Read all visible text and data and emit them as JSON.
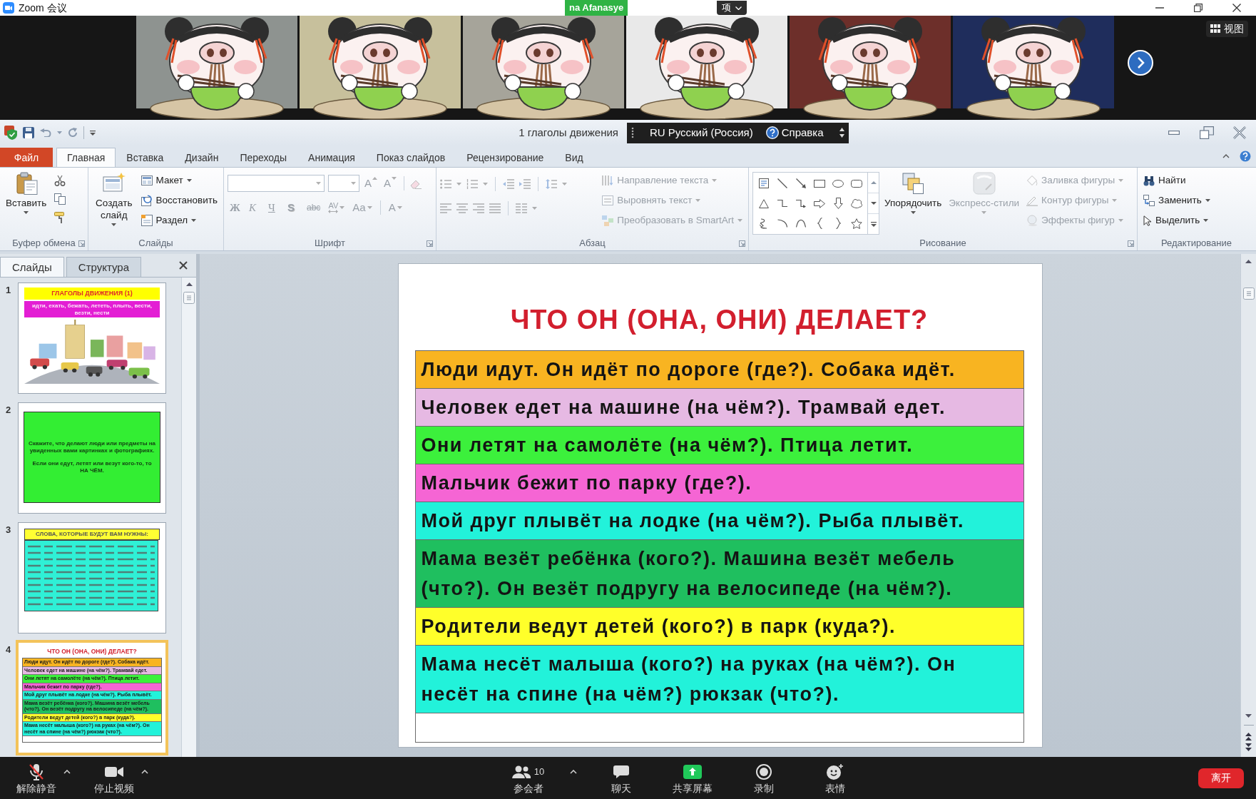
{
  "zoom_window": {
    "title": "Zoom 会议",
    "share_label": "na Afanasye",
    "options_button": "项",
    "view_button": "视图"
  },
  "powerpoint": {
    "title": "1 глаголы движения",
    "language_bar": {
      "code": "RU",
      "language": "Русский (Россия)",
      "help": "Справка"
    },
    "tabs": [
      {
        "label": "Файл",
        "kind": "file",
        "selected": false
      },
      {
        "label": "Главная",
        "kind": "tab",
        "selected": true
      },
      {
        "label": "Вставка",
        "kind": "tab",
        "selected": false
      },
      {
        "label": "Дизайн",
        "kind": "tab",
        "selected": false
      },
      {
        "label": "Переходы",
        "kind": "tab",
        "selected": false
      },
      {
        "label": "Анимация",
        "kind": "tab",
        "selected": false
      },
      {
        "label": "Показ слайдов",
        "kind": "tab",
        "selected": false
      },
      {
        "label": "Рецензирование",
        "kind": "tab",
        "selected": false
      },
      {
        "label": "Вид",
        "kind": "tab",
        "selected": false
      }
    ],
    "ribbon_groups": [
      {
        "kind": "clipboard",
        "title": "Буфер обмена",
        "launcher": true,
        "disabled": false,
        "large_buttons": [
          {
            "label": "Вставить",
            "dropdown": true,
            "disabled": false
          }
        ]
      },
      {
        "kind": "slides",
        "title": "Слайды",
        "launcher": false,
        "disabled": false,
        "large_buttons": [
          {
            "label": "Создать слайд",
            "dropdown": true,
            "disabled": false
          }
        ],
        "buttons": [
          {
            "label": "Макет",
            "dropdown": true,
            "disabled": false
          },
          {
            "label": "Восстановить",
            "dropdown": false,
            "disabled": false
          },
          {
            "label": "Раздел",
            "dropdown": true,
            "disabled": false
          }
        ]
      },
      {
        "kind": "font",
        "title": "Шрифт",
        "launcher": true,
        "disabled": true,
        "size_buttons": [
          {
            "text": "A",
            "kind": "grow"
          },
          {
            "text": "A",
            "kind": "shrink"
          }
        ],
        "format_buttons": [
          {
            "text": "Ж",
            "kind": "bold"
          },
          {
            "text": "К",
            "kind": "italic"
          },
          {
            "text": "Ч",
            "kind": "underline"
          },
          {
            "text": "S",
            "kind": "shadow"
          },
          {
            "text": "abc",
            "kind": "strike"
          },
          {
            "text": "AV",
            "kind": "spacing"
          },
          {
            "text": "Aa",
            "kind": "case"
          },
          {
            "text": "A",
            "kind": "color"
          }
        ]
      },
      {
        "kind": "paragraph",
        "title": "Абзац",
        "launcher": true,
        "disabled": true,
        "buttons": [
          {
            "label": "Направление текста",
            "dropdown": true
          },
          {
            "label": "Выровнять текст",
            "dropdown": true
          },
          {
            "label": "Преобразовать в SmartArt",
            "dropdown": true
          }
        ]
      },
      {
        "kind": "drawing",
        "title": "Рисование",
        "launcher": true,
        "disabled": false,
        "large_buttons": [
          {
            "label": "Упорядочить",
            "dropdown": true,
            "disabled": false
          },
          {
            "label": "Экспресс-стили",
            "dropdown": true,
            "disabled": true
          }
        ],
        "buttons": [
          {
            "label": "Заливка фигуры",
            "dropdown": true,
            "disabled": true
          },
          {
            "label": "Контур фигуры",
            "dropdown": true,
            "disabled": true
          },
          {
            "label": "Эффекты фигур",
            "dropdown": true,
            "disabled": true
          }
        ]
      },
      {
        "kind": "editing",
        "title": "Редактирование",
        "launcher": false,
        "disabled": false,
        "buttons": [
          {
            "label": "Найти",
            "dropdown": false,
            "disabled": false
          },
          {
            "label": "Заменить",
            "dropdown": true,
            "disabled": false
          },
          {
            "label": "Выделить",
            "dropdown": true,
            "disabled": false
          }
        ]
      }
    ],
    "slides_pane": {
      "tabs": [
        {
          "label": "Слайды",
          "selected": true
        },
        {
          "label": "Структура",
          "selected": false
        }
      ],
      "thumbnails": [
        {
          "number": "1",
          "kind": "title",
          "selected": false,
          "title": "ГЛАГОЛЫ ДВИЖЕНИЯ (1)",
          "subtitle": "идти, ехать, бежать, лететь, плыть, вести, везти, нести"
        },
        {
          "number": "2",
          "kind": "text",
          "selected": false,
          "paragraphs": [
            "Скажите, что делают люди или предметы на увиденных вами картинках и фотографиях.",
            "Если они едут, летят или везут кого-то, то НА ЧЁМ."
          ]
        },
        {
          "number": "3",
          "kind": "word_list",
          "selected": false,
          "title": "СЛОВА, КОТОРЫЕ БУДУТ ВАМ НУЖНЫ:"
        },
        {
          "number": "4",
          "kind": "table",
          "selected": true,
          "title": "ЧТО ОН (ОНА, ОНИ) ДЕЛАЕТ?",
          "rows": [
            {
              "text": "Люди идут. Он идёт по дороге (где?). Собака идёт.",
              "color": "#f8b421"
            },
            {
              "text": "Человек едет на машине (на чём?). Трамвай едет.",
              "color": "#e6b9e3"
            },
            {
              "text": "Они летят на самолёте (на чём?). Птица летит.",
              "color": "#3cf03c"
            },
            {
              "text": "Мальчик бежит по парку (где?).",
              "color": "#f565d4"
            },
            {
              "text": "Мой друг плывёт на лодке (на чём?). Рыба плывёт.",
              "color": "#22f2da"
            },
            {
              "text": "Мама везёт ребёнка (кого?). Машина везёт мебель (что?). Он везёт подругу на велосипеде (на чём?).",
              "color": "#1fbf5f"
            },
            {
              "text": "Родители ведут детей (кого?) в парк (куда?).",
              "color": "#ffff2a"
            },
            {
              "text": "Мама несёт малыша (кого?) на руках (на чём?). Он несёт на спине (на чём?) рюкзак (что?).",
              "color": "#22f2da"
            }
          ]
        }
      ]
    },
    "slide": {
      "title": "ЧТО ОН (ОНА, ОНИ) ДЕЛАЕТ?",
      "rows": [
        {
          "text": "Люди идут. Он идёт по дороге (где?). Собака идёт.",
          "color": "#f8b421"
        },
        {
          "text": "Человек едет на машине (на чём?). Трамвай едет.",
          "color": "#e6b9e3"
        },
        {
          "text": "Они летят на самолёте (на чём?). Птица летит.",
          "color": "#3cf03c"
        },
        {
          "text": "Мальчик бежит по парку (где?).",
          "color": "#f565d4"
        },
        {
          "text": "Мой друг плывёт на лодке (на чём?). Рыба плывёт.",
          "color": "#22f2da"
        },
        {
          "text": "Мама везёт ребёнка (кого?). Машина везёт мебель (что?). Он везёт подругу на велосипеде (на чём?).",
          "color": "#1fbf5f"
        },
        {
          "text": "Родители ведут детей (кого?) в парк (куда?).",
          "color": "#ffff2a"
        },
        {
          "text": "Мама несёт малыша (кого?) на руках (на чём?). Он несёт на спине (на чём?) рюкзак (что?).",
          "color": "#22f2da"
        }
      ]
    }
  },
  "zoom_toolbar": {
    "left_items": [
      {
        "label": "解除静音",
        "kind": "unmute",
        "menu": true
      },
      {
        "label": "停止视频",
        "kind": "video",
        "menu": true
      }
    ],
    "center_items": [
      {
        "label": "参会者",
        "kind": "participants",
        "count": "10",
        "menu": true
      },
      {
        "label": "聊天",
        "kind": "chat",
        "menu": false
      },
      {
        "label": "共享屏幕",
        "kind": "share",
        "menu": false
      },
      {
        "label": "录制",
        "kind": "record",
        "menu": false
      },
      {
        "label": "表情",
        "kind": "reactions",
        "menu": false
      }
    ],
    "leave_button": "离开"
  }
}
